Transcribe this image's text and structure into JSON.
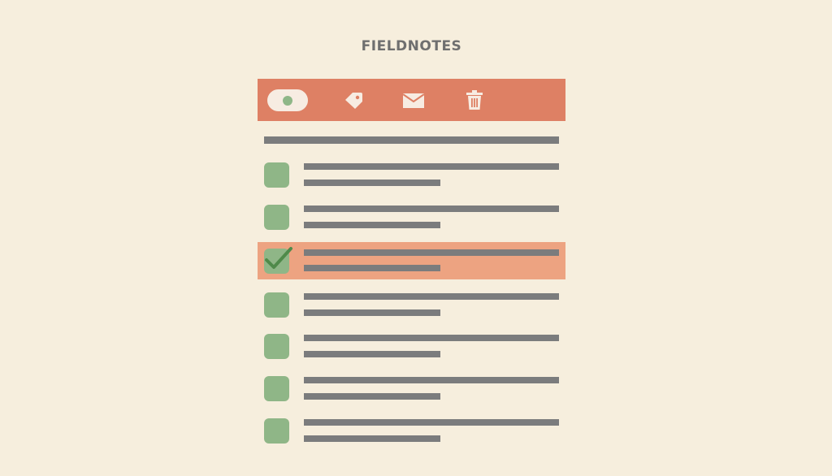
{
  "app": {
    "title": "FIELDNOTES"
  },
  "toolbar": {
    "buttons": [
      {
        "name": "toggle",
        "icon": "toggle-icon"
      },
      {
        "name": "tag",
        "icon": "tag-icon"
      },
      {
        "name": "mail",
        "icon": "mail-icon"
      },
      {
        "name": "trash",
        "icon": "trash-icon"
      }
    ]
  },
  "list": {
    "items": [
      {
        "checked": false,
        "selected": false
      },
      {
        "checked": false,
        "selected": false
      },
      {
        "checked": true,
        "selected": true
      },
      {
        "checked": false,
        "selected": false
      },
      {
        "checked": false,
        "selected": false
      },
      {
        "checked": false,
        "selected": false
      },
      {
        "checked": false,
        "selected": false
      }
    ]
  },
  "colors": {
    "background": "#f6eedd",
    "toolbar": "#de8064",
    "selected_row": "#eda381",
    "checkbox": "#8fb687",
    "check_mark": "#4f8a4a",
    "text_line": "#7b7c7d",
    "icon": "#f7ece2"
  }
}
